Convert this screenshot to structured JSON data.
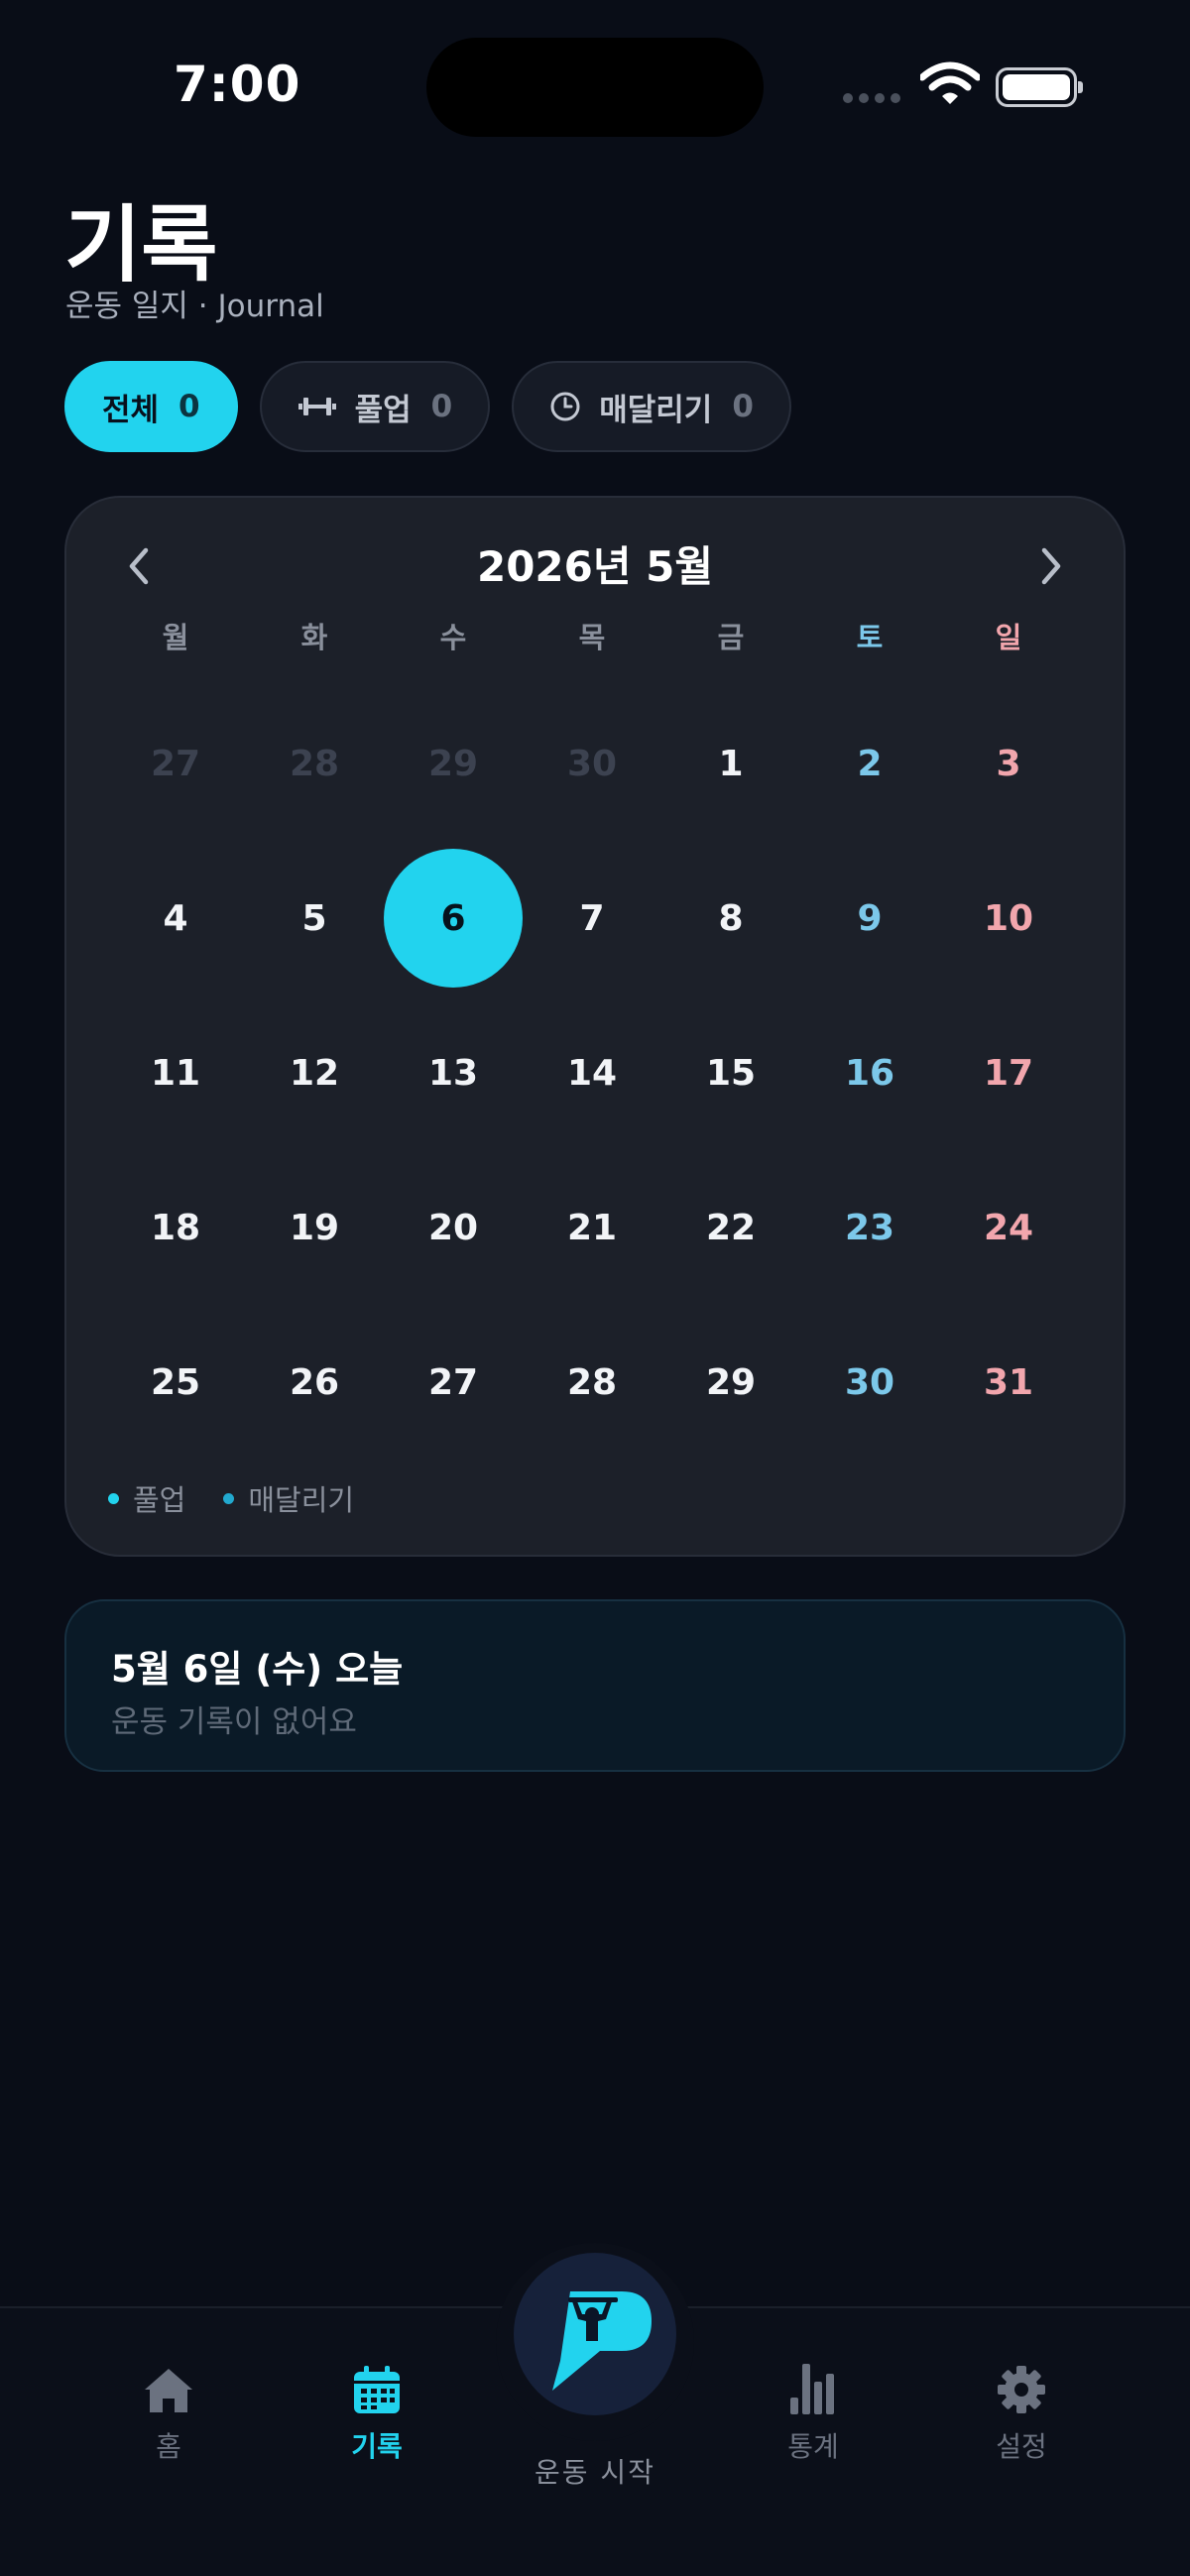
{
  "status_bar": {
    "time": "7:00"
  },
  "header": {
    "title": "기록",
    "subtitle": "운동 일지 · Journal"
  },
  "filters": [
    {
      "label": "전체",
      "count": "0",
      "icon": "",
      "active": true
    },
    {
      "label": "풀업",
      "count": "0",
      "icon": "dumbbell-icon",
      "active": false
    },
    {
      "label": "매달리기",
      "count": "0",
      "icon": "clock-icon",
      "active": false
    }
  ],
  "calendar": {
    "month_label": "2026년 5월",
    "weekdays": [
      "월",
      "화",
      "수",
      "목",
      "금",
      "토",
      "일"
    ],
    "days": [
      {
        "d": "27",
        "m": true
      },
      {
        "d": "28",
        "m": true
      },
      {
        "d": "29",
        "m": true
      },
      {
        "d": "30",
        "m": true
      },
      {
        "d": "1"
      },
      {
        "d": "2"
      },
      {
        "d": "3"
      },
      {
        "d": "4"
      },
      {
        "d": "5"
      },
      {
        "d": "6",
        "today": true
      },
      {
        "d": "7"
      },
      {
        "d": "8"
      },
      {
        "d": "9"
      },
      {
        "d": "10"
      },
      {
        "d": "11"
      },
      {
        "d": "12"
      },
      {
        "d": "13"
      },
      {
        "d": "14"
      },
      {
        "d": "15"
      },
      {
        "d": "16"
      },
      {
        "d": "17"
      },
      {
        "d": "18"
      },
      {
        "d": "19"
      },
      {
        "d": "20"
      },
      {
        "d": "21"
      },
      {
        "d": "22"
      },
      {
        "d": "23"
      },
      {
        "d": "24"
      },
      {
        "d": "25"
      },
      {
        "d": "26"
      },
      {
        "d": "27"
      },
      {
        "d": "28"
      },
      {
        "d": "29"
      },
      {
        "d": "30"
      },
      {
        "d": "31"
      }
    ],
    "legend": [
      {
        "label": "풀업",
        "color": "#22d3ee"
      },
      {
        "label": "매달리기",
        "color": "#22a9cf"
      }
    ]
  },
  "day_detail": {
    "title": "5월 6일 (수)  오늘",
    "empty_text": "운동 기록이 없어요"
  },
  "tabbar": {
    "home": "홈",
    "journal": "기록",
    "start": "운동 시작",
    "stats": "통계",
    "settings": "설정"
  },
  "colors": {
    "accent": "#22d3ee",
    "saturday": "#7cc8ea",
    "sunday": "#f2a6ad",
    "background": "#090d17"
  }
}
